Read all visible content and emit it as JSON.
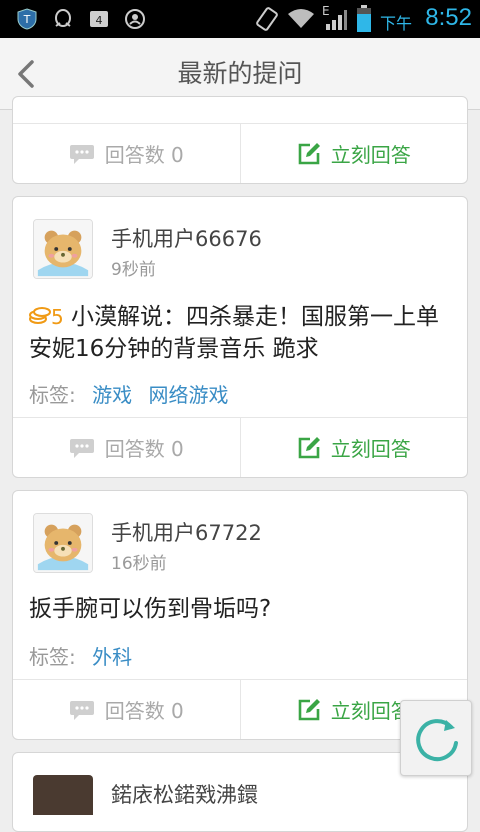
{
  "status_bar": {
    "network_label": "E",
    "ampm": "下午",
    "time": "8:52",
    "time_color": "#2fb7e8",
    "icons": [
      "shield-icon",
      "qq-icon",
      "sim-icon",
      "privacy-icon",
      "vibrate-icon",
      "wifi-icon",
      "signal-icon",
      "battery-icon"
    ]
  },
  "header": {
    "title": "最新的提问",
    "back_icon": "back-arrow-icon"
  },
  "cards": [
    {
      "answers_label": "回答数 0",
      "answer_now_label": "立刻回答"
    },
    {
      "user": "手机用户66676",
      "time": "9秒前",
      "reward": "5",
      "question": "小漠解说：四杀暴走！国服第一上单安妮16分钟的背景音乐 跪求",
      "tags_label": "标签:",
      "tags": [
        "游戏",
        "网络游戏"
      ],
      "answers_label": "回答数 0",
      "answer_now_label": "立刻回答"
    },
    {
      "user": "手机用户67722",
      "time": "16秒前",
      "question": "扳手腕可以伤到骨垢吗?",
      "tags_label": "标签:",
      "tags": [
        "外科"
      ],
      "answers_label": "回答数 0",
      "answer_now_label": "立刻回答"
    },
    {
      "user": "鍩庡松鍩戣沸鐶"
    }
  ],
  "colors": {
    "accent_green": "#3aa545",
    "tag_blue": "#3a8dc5",
    "coin_orange": "#f09a15"
  }
}
